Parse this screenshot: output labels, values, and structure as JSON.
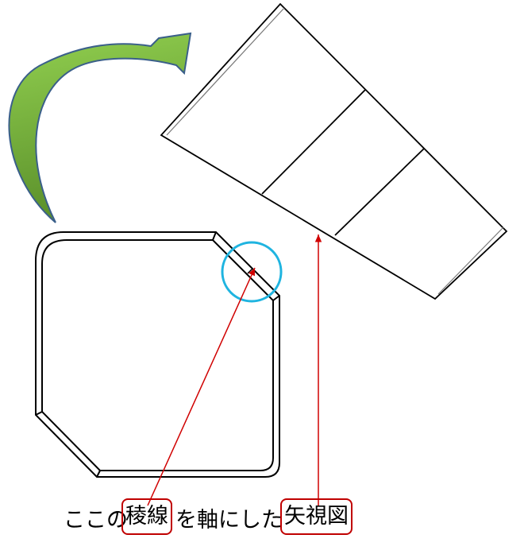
{
  "caption": {
    "part1": "ここの",
    "boxed1": "稜線",
    "part2": "を軸にした",
    "boxed2": "矢視図"
  },
  "colors": {
    "arrow_fill_top": "#92d050",
    "arrow_fill_bottom": "#5a8f2a",
    "arrow_stroke": "#3a5f8a",
    "highlight_circle": "#1fb4e0",
    "pointer_lines": "#d00000",
    "box_border": "#c00000",
    "drawing_lines": "#000000"
  }
}
